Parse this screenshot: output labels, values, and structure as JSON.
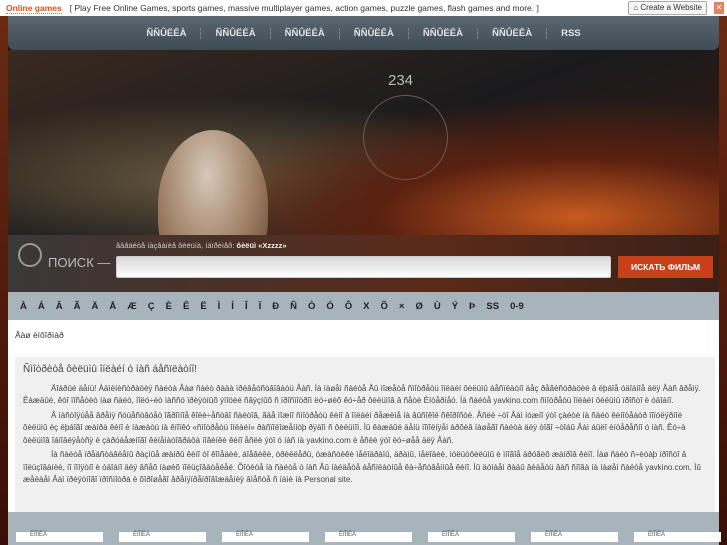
{
  "topbar": {
    "brand": "Online games",
    "tagline": "[ Play Free Online Games, sports games, massive multiplayer games, action games, puzzle games, flash games and more. ]",
    "create": "Create a Website"
  },
  "nav": [
    "ÑÑÛËÊÀ",
    "ÑÑÛËÊÀ",
    "ÑÑÛËÊÀ",
    "ÑÑÛËÊÀ",
    "ÑÑÛËÊÀ",
    "ÑÑÛËÊÀ",
    "RSS"
  ],
  "banner": {
    "speed": "234"
  },
  "search": {
    "label": "ПОИСК —",
    "hint": "ââåäèòå íàçâàíèå ôèëüìà, íàïðèìåð:",
    "hint_example": "ôèëüì «Xzzzz»",
    "button": "ИСКАТЬ ФИЛЬМ",
    "value": ""
  },
  "letters": [
    "À",
    "Á",
    "Â",
    "Ã",
    "Ä",
    "Å",
    "Æ",
    "Ç",
    "È",
    "Ê",
    "Ë",
    "Ì",
    "Í",
    "Î",
    "Ï",
    "Ð",
    "Ñ",
    "Ò",
    "Ó",
    "Ô",
    "X",
    "Õ",
    "×",
    "Ø",
    "Ù",
    "Ý",
    "Þ",
    "SS",
    "0-9"
  ],
  "breadcrumb": "Âàø èíôîðìàð",
  "article": {
    "title": "Ñìîòðèòå ôèëüìû îíëàéí ó íàñ áåñïëàòíî!",
    "paragraphs": [
      "Äîáðûé äåíü! Àäìèíèñòðàöèÿ ñàéòà Âàø ñàéò ðàäà ïðèâåòñòâîâàòü Âàñ. Íà íàøåì ñàéòå Âû ìîæåòå ñìîòðåòü îíëàéí ôèëüìû áåñïëàòíî áåç ðåãèñòðàöèè â ëþáîå óäîáíîå äëÿ Âàñ âðåìÿ. Êàæäûé, êòî ïîñåòèò íàø ñàéò, ïîëó÷èò ìàññó ïðèÿòíûõ ýìîöèé ñâÿçíûõ ñ ïðîñìîòðîì ëó÷øèõ êó÷åð ôèëüìîâ â ñåòè Èíòåðíåò. Íà ñàéòå yavkino.com ñìîòðåòü îíëàéí ôèëüìû ïðîñòî è óäîáíî.",
      "Â íàñòîÿùåå âðåìÿ ñóùåñòâóåò îãðîìíîå êîëè÷åñòâî ñàéòîâ, ãäå ìîæíî ñìîòðåòü êèíî â îíëàéí ðåæèìå íà âûñîêîé ñêîðîñòè. Åñëè ÷òî Âàì íóæíî ýòî çàéòè íà ñàéò êèíîòåàòð ïîïóëÿðíîé ôèëüìû èç ëþáîãî æàíðà êèíî è íàæàòü íà êíîïêó «ñìîòðåòü îíëàéí» ðàñïîëîæåííóþ ðÿäîì ñ ôèëüìîì. Ìû êàæäûé äåíü ïîïîëíÿåì àðõèâ íàøåãî ñàéòà äëÿ òîãî ÷òîáû Âàì áûëî èíòåðåñíî ó íàñ. Êó÷à ôèëüìîâ îáíîâëÿåòñÿ è çàðóáåæíîãî êèíåìàòîãðàôà íîâèíêè êèíî åñëè ýòî ó íàñ íà yavkino.com è åñëè ýòî ëó÷øåå äëÿ Âàñ.",
      "Íà ñàéòå ïðåäñòàâëåíû ðàçíûå æàíðû êèíî òî êîìåäèè, áîåâèêè, òðèëëåðû, óæàñòèêè ìåëîäðàìû, äðàìû, ìåëîäèè, ìóëüòôèëüìû è ìíîãîå äðóãèõ æàíðîâ êèíî. Íàø ñàéò ñ÷èòàþ ïðîñòî â ïîëüçîâàíèè, íî ïîíÿòíî è óäîáíî äëÿ âñåõ íàøèõ ïîëüçîâàòåëåé. Õîòèòå íà ñàéòå ó íàñ Âû íàéäåòå áåñïëàòíûå êà÷åñòâåííûå êèíî. Ìû äóìàåì ðàäû âèäåòü âàñ ñíîâà íà íàøåì ñàéòå yavkino.com. Ìû æåëàåì Âàì ïðèÿòíîãî ïðîñìîòðà è õîðîøåãî âðåìÿïðåïðîâîæäåíèÿ âìåñòå ñ íàìè íà Personal site."
    ]
  },
  "bottom_buttons": [
    "ÊÍÎÏÊÀ",
    "ÊÍÎÏÊÀ",
    "ÊÍÎÏÊÀ",
    "ÊÍÎÏÊÀ",
    "ÊÍÎÏÊÀ",
    "ÊÍÎÏÊÀ",
    "ÊÍÎÏÊÀ"
  ]
}
